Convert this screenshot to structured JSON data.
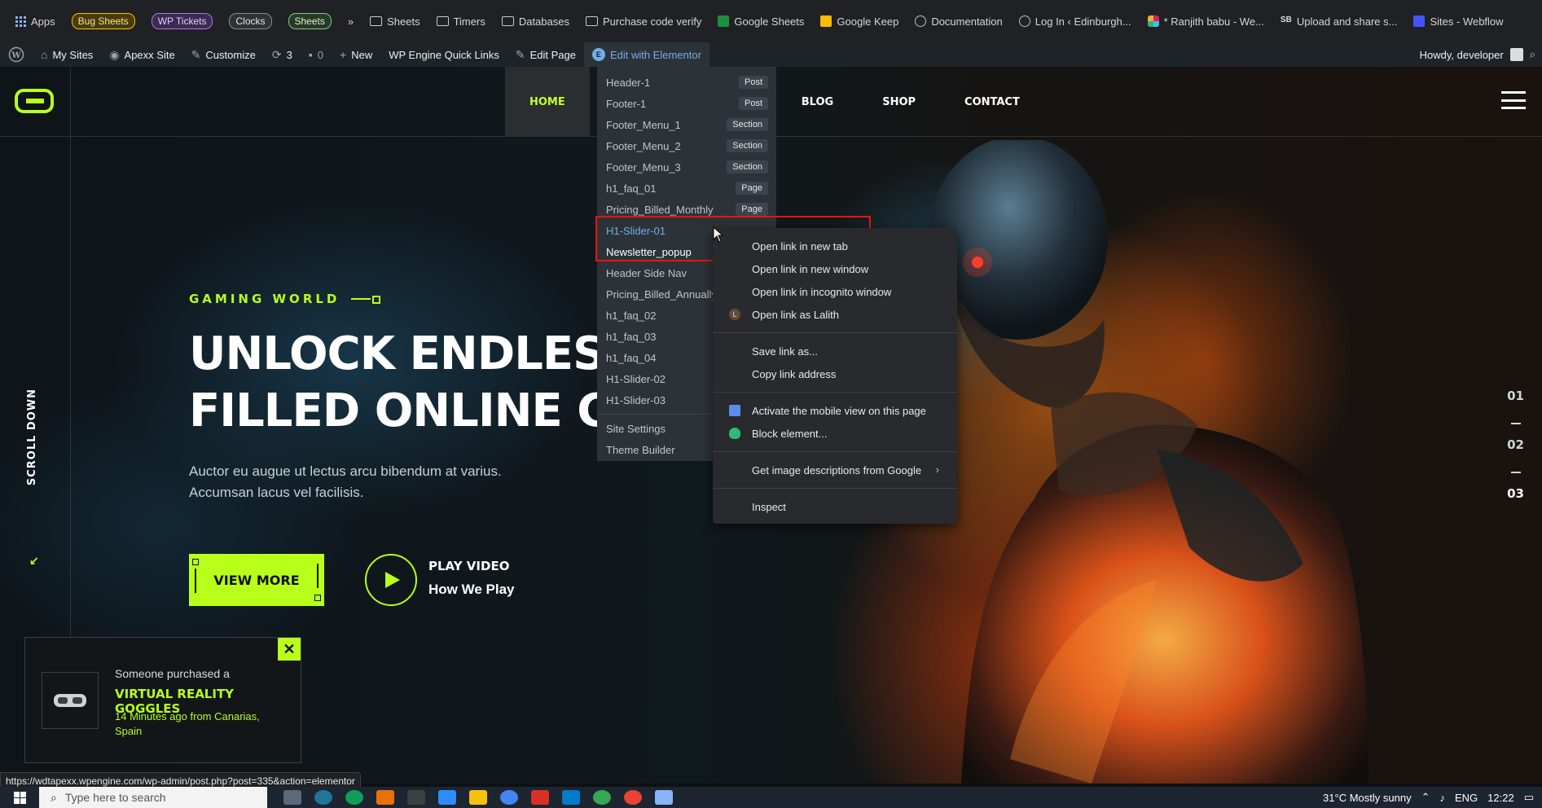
{
  "bookmarks": {
    "apps": "Apps",
    "bug_sheets": "Bug Sheets",
    "wp_tickets": "WP Tickets",
    "clocks": "Clocks",
    "sheets_chip": "Sheets",
    "more": "»",
    "folders": [
      "Sheets",
      "Timers",
      "Databases",
      "Purchase code verify"
    ],
    "google_sheets": "Google Sheets",
    "google_keep": "Google Keep",
    "documentation": "Documentation",
    "login": "Log In ‹ Edinburgh...",
    "ranjith": "* Ranjith babu - We...",
    "upload": "Upload and share s...",
    "webflow": "Sites - Webflow"
  },
  "wpbar": {
    "my_sites": "My Sites",
    "apexx": "Apexx Site",
    "customize": "Customize",
    "updates": "3",
    "comments": "0",
    "new": "New",
    "quick_links": "WP Engine Quick Links",
    "edit_page": "Edit Page",
    "edit_elementor": "Edit with Elementor",
    "howdy": "Howdy, developer"
  },
  "nav": {
    "home": "HOME",
    "blog": "BLOG",
    "shop": "SHOP",
    "contact": "CONTACT"
  },
  "hero": {
    "eyebrow": "GAMING WORLD",
    "line1": "UNLOCK ENDLESS",
    "line2": "FILLED ONLINE GA",
    "sub": "Auctor eu augue ut lectus arcu bibendum at varius. Accumsan lacus vel facilisis.",
    "view_more": "VIEW MORE",
    "play_video": "PLAY VIDEO",
    "how_we_play": "How We Play",
    "scroll_down": "SCROLL DOWN"
  },
  "slides": [
    "01",
    "02",
    "03"
  ],
  "purchase": {
    "who": "Someone purchased a",
    "product": "VIRTUAL REALITY GOGGLES",
    "ago": "14 Minutes ago from Canarias, Spain",
    "close": "✕"
  },
  "dropdown": {
    "items": [
      {
        "label": "Header-1",
        "badge": "Post"
      },
      {
        "label": "Footer-1",
        "badge": "Post"
      },
      {
        "label": "Footer_Menu_1",
        "badge": "Section"
      },
      {
        "label": "Footer_Menu_2",
        "badge": "Section"
      },
      {
        "label": "Footer_Menu_3",
        "badge": "Section"
      },
      {
        "label": "h1_faq_01",
        "badge": "Page"
      },
      {
        "label": "Pricing_Billed_Monthly",
        "badge": "Page"
      },
      {
        "label": "H1-Slider-01",
        "badge": ""
      },
      {
        "label": "Newsletter_popup",
        "badge": ""
      },
      {
        "label": "Header Side Nav",
        "badge": ""
      },
      {
        "label": "Pricing_Billed_Annually",
        "badge": ""
      },
      {
        "label": "h1_faq_02",
        "badge": ""
      },
      {
        "label": "h1_faq_03",
        "badge": ""
      },
      {
        "label": "h1_faq_04",
        "badge": ""
      },
      {
        "label": "H1-Slider-02",
        "badge": ""
      },
      {
        "label": "H1-Slider-03",
        "badge": ""
      }
    ],
    "site_settings": "Site Settings",
    "theme_builder": "Theme Builder"
  },
  "context_menu": {
    "open_new_tab": "Open link in new tab",
    "open_new_window": "Open link in new window",
    "open_incognito": "Open link in incognito window",
    "open_as": "Open link as Lalith",
    "profile_initial": "L",
    "save_link": "Save link as...",
    "copy_link": "Copy link address",
    "mobile_view": "Activate the mobile view on this page",
    "block_element": "Block element...",
    "image_desc": "Get image descriptions from Google",
    "inspect": "Inspect"
  },
  "status_url": "https://wdtapexx.wpengine.com/wp-admin/post.php?post=335&action=elementor",
  "taskbar": {
    "search_placeholder": "Type here to search",
    "weather": "31°C  Mostly sunny",
    "lang": "ENG",
    "time": "12:22"
  },
  "colors": {
    "accent": "#b8ff1a",
    "wp_admin": "#1d2327",
    "highlight_red": "#e11111"
  }
}
